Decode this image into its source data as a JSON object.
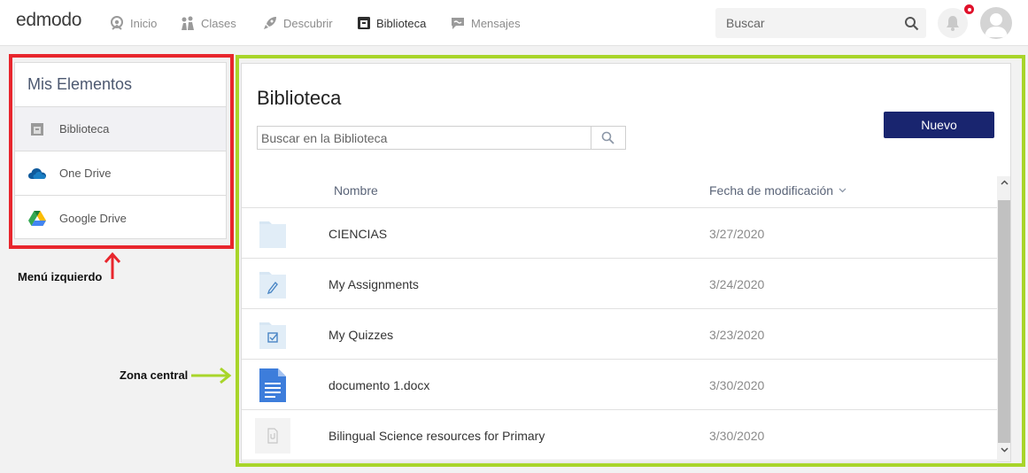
{
  "topbar": {
    "logo": "edmodo",
    "nav": [
      {
        "label": "Inicio"
      },
      {
        "label": "Clases"
      },
      {
        "label": "Descubrir"
      },
      {
        "label": "Biblioteca"
      },
      {
        "label": "Mensajes"
      }
    ],
    "search_placeholder": "Buscar"
  },
  "sidebar": {
    "title": "Mis Elementos",
    "items": [
      {
        "label": "Biblioteca",
        "icon": "library-box-icon"
      },
      {
        "label": "One Drive",
        "icon": "onedrive-cloud-icon"
      },
      {
        "label": "Google Drive",
        "icon": "google-drive-icon"
      }
    ]
  },
  "annotations": {
    "left_menu": "Menú izquierdo",
    "center_zone": "Zona central"
  },
  "main": {
    "title": "Biblioteca",
    "search_placeholder": "Buscar en la Biblioteca",
    "new_button": "Nuevo",
    "columns": {
      "name": "Nombre",
      "date": "Fecha de modificación"
    },
    "rows": [
      {
        "name": "CIENCIAS",
        "date": "3/27/2020",
        "icon": "folder-icon"
      },
      {
        "name": "My Assignments",
        "date": "3/24/2020",
        "icon": "assignment-folder-icon"
      },
      {
        "name": "My Quizzes",
        "date": "3/23/2020",
        "icon": "quiz-folder-icon"
      },
      {
        "name": "documento 1.docx",
        "date": "3/30/2020",
        "icon": "google-doc-icon"
      },
      {
        "name": "Bilingual Science resources for Primary",
        "date": "3/30/2020",
        "icon": "resource-file-icon"
      }
    ]
  },
  "colors": {
    "accent_button": "#19256f",
    "frame_red": "#e8262d",
    "frame_green": "#a8d52a",
    "notification_badge": "#e0112b"
  }
}
